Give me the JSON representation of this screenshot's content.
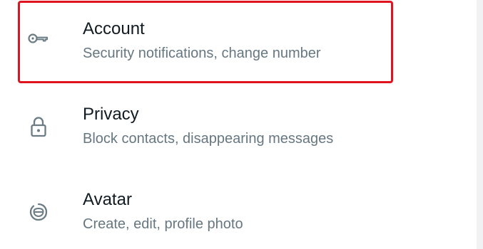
{
  "settings": {
    "items": [
      {
        "icon": "key-icon",
        "title": "Account",
        "subtitle": "Security notifications, change number"
      },
      {
        "icon": "lock-icon",
        "title": "Privacy",
        "subtitle": "Block contacts, disappearing messages"
      },
      {
        "icon": "avatar-face-icon",
        "title": "Avatar",
        "subtitle": "Create, edit, profile photo"
      }
    ]
  },
  "colors": {
    "title_text": "#111b21",
    "subtitle_text": "#667781",
    "icon": "#6b7c85",
    "highlight": "#e0141e",
    "right_strip": "#f1f2f3"
  }
}
